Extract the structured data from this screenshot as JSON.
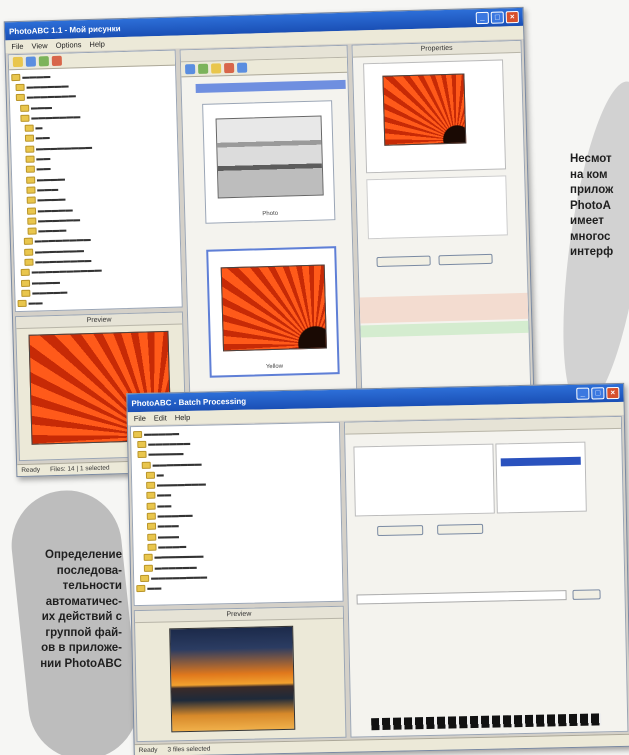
{
  "captions": {
    "top": "Несмот\nна ком\nприлож\nPhotoA\nимеет \nмногос\nинтерф",
    "bottom": "Определение\nпоследова-\nтельности\nавтоматичес-\nих действий с\nгруппой фай-\nов в приложе-\nнии PhotoABC"
  },
  "window_main": {
    "title": "PhotoABC 1.1 - Мой рисунки",
    "menu": [
      "File",
      "View",
      "Options",
      "Help"
    ],
    "preview_header": "Preview",
    "properties_header": "Properties",
    "thumb_labels": [
      "Photo",
      "Yellow"
    ],
    "status": [
      "Ready",
      "Files: 14  |  1 selected"
    ]
  },
  "window_batch": {
    "title": "PhotoABC - Batch Processing",
    "menu": [
      "File",
      "Edit",
      "Help"
    ],
    "preview_header": "Preview",
    "status": [
      "Ready",
      "3 files selected"
    ]
  },
  "colors": {
    "title_blue": "#1a4fb5",
    "accent_orange": "#d53a0b"
  }
}
